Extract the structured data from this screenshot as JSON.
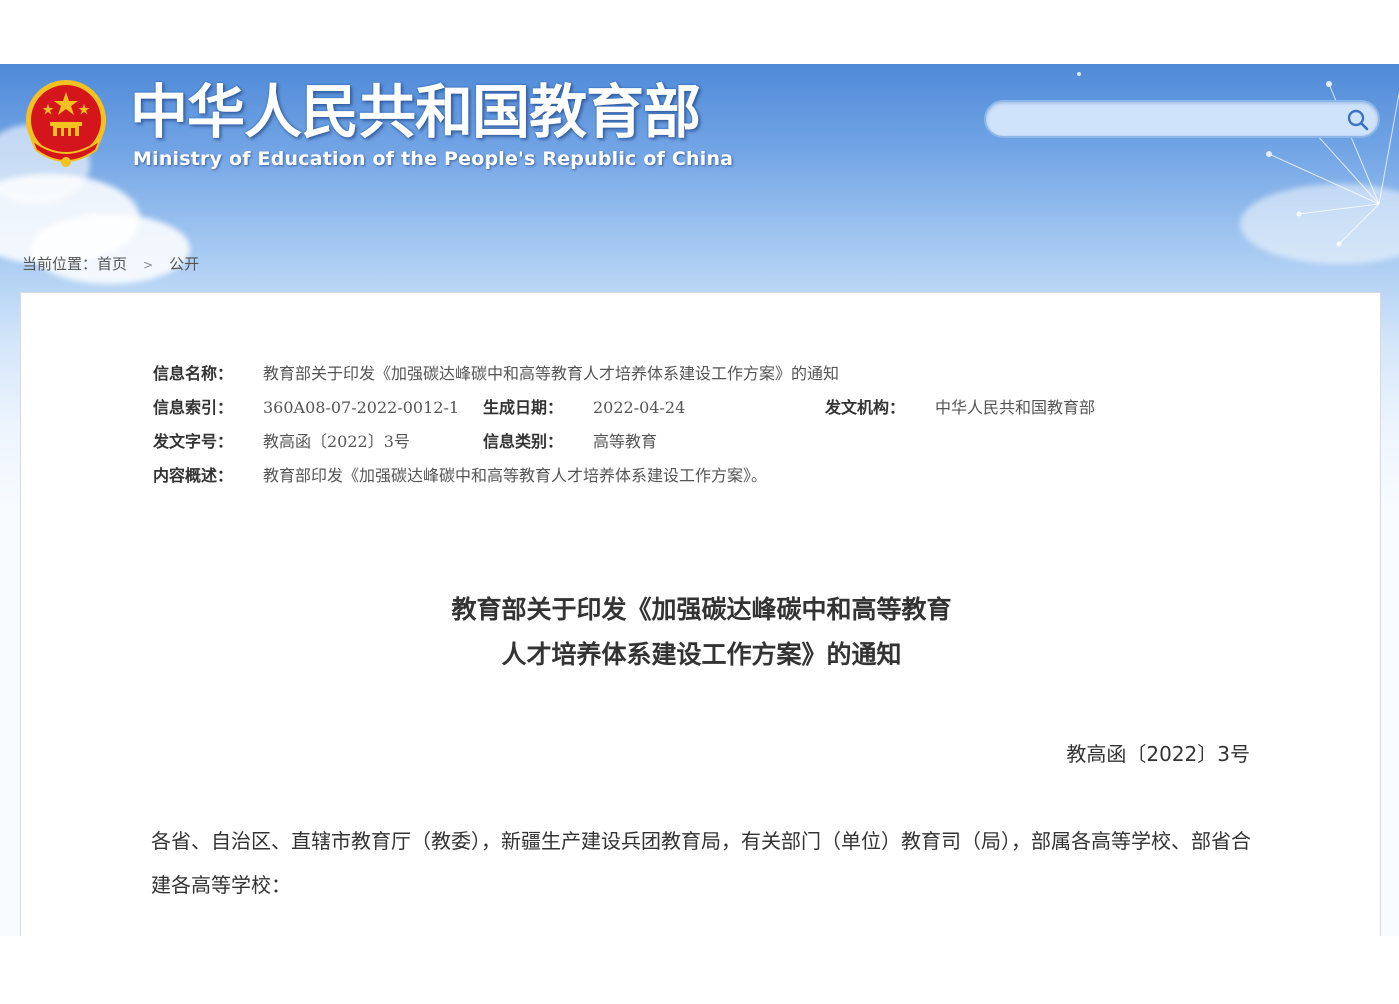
{
  "header": {
    "site_title": "中华人民共和国教育部",
    "site_subtitle": "Ministry of Education of the People's Republic of China",
    "search": {
      "placeholder": "",
      "value": ""
    }
  },
  "breadcrumb": {
    "prefix": "当前位置：",
    "items": [
      "首页",
      "公开"
    ],
    "separator": ">"
  },
  "meta": {
    "name_label": "信息名称：",
    "name_value": "教育部关于印发《加强碳达峰碳中和高等教育人才培养体系建设工作方案》的通知",
    "index_label": "信息索引：",
    "index_value": "360A08-07-2022-0012-1",
    "date_label": "生成日期：",
    "date_value": "2022-04-24",
    "issuer_label": "发文机构：",
    "issuer_value": "中华人民共和国教育部",
    "docno_label": "发文字号：",
    "docno_value": "教高函〔2022〕3号",
    "category_label": "信息类别：",
    "category_value": "高等教育",
    "summary_label": "内容概述：",
    "summary_value": "教育部印发《加强碳达峰碳中和高等教育人才培养体系建设工作方案》。"
  },
  "document": {
    "title_line1": "教育部关于印发《加强碳达峰碳中和高等教育",
    "title_line2": "人才培养体系建设工作方案》的通知",
    "number": "教高函〔2022〕3号",
    "salutation": "各省、自治区、直辖市教育厅（教委），新疆生产建设兵团教育局，有关部门（单位）教育司（局），部属各高等学校、部省合建各高等学校："
  },
  "colors": {
    "header_blue": "#4f8ad8",
    "emblem_red": "#d4161c",
    "emblem_gold": "#f3c220",
    "text_dark": "#333333",
    "text_muted": "#555555"
  }
}
